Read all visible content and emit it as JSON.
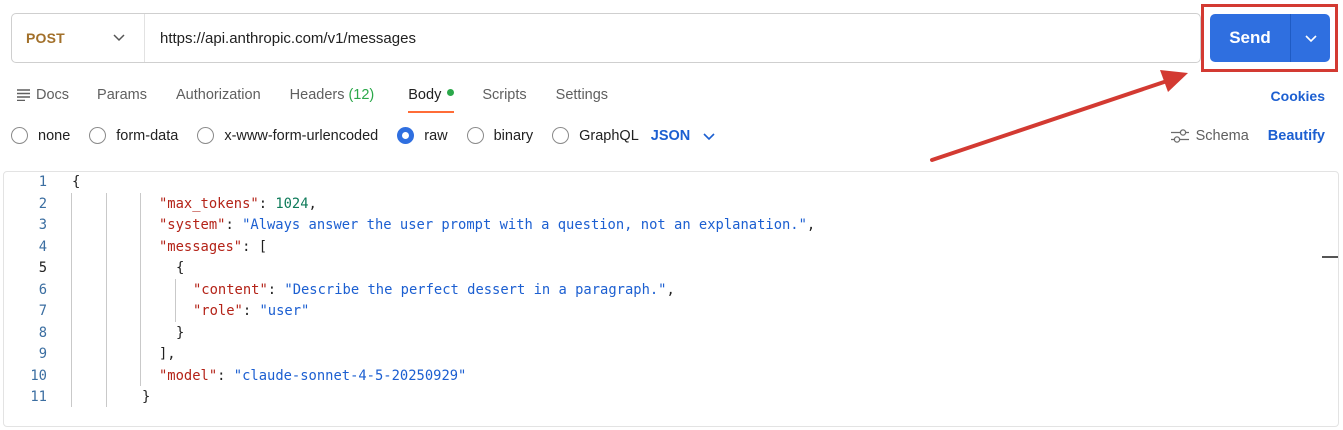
{
  "request": {
    "method": "POST",
    "url": "https://api.anthropic.com/v1/messages",
    "send_label": "Send"
  },
  "tabs": [
    {
      "label": "Docs"
    },
    {
      "label": "Params"
    },
    {
      "label": "Authorization"
    },
    {
      "label": "Headers",
      "count": "(12)"
    },
    {
      "label": "Body",
      "active": true
    },
    {
      "label": "Scripts"
    },
    {
      "label": "Settings"
    }
  ],
  "cookies_label": "Cookies",
  "body_types": [
    {
      "label": "none",
      "checked": false
    },
    {
      "label": "form-data",
      "checked": false
    },
    {
      "label": "x-www-form-urlencoded",
      "checked": false
    },
    {
      "label": "raw",
      "checked": true
    },
    {
      "label": "binary",
      "checked": false
    },
    {
      "label": "GraphQL",
      "checked": false
    }
  ],
  "format": "JSON",
  "schema_label": "Schema",
  "beautify_label": "Beautify",
  "editor": {
    "current_line": 5,
    "lines": [
      "{",
      "\"max_tokens\": 1024,",
      "\"system\": \"Always answer the user prompt with a question, not an explanation.\",",
      "\"messages\": [",
      "{",
      "\"content\": \"Describe the perfect dessert in a paragraph.\",",
      "\"role\": \"user\"",
      "}",
      "],",
      "\"model\": \"claude-sonnet-4-5-20250929\"",
      "}"
    ]
  },
  "colors": {
    "method": "#a2702a",
    "accent_blue": "#2f6fe0",
    "link_blue": "#1c5fd1",
    "annotation_red": "#d33a32",
    "active_tab_underline": "#ff6c37",
    "json_key": "#b42318",
    "json_string": "#1c5fd1",
    "json_number": "#0f7b5a"
  }
}
